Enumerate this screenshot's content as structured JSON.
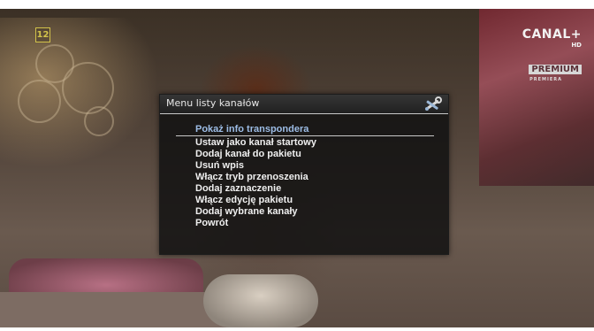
{
  "overlay": {
    "age_rating": "12",
    "channel_logo": {
      "brand": "CANAL+",
      "hd": "HD",
      "tier": "PREMIUM",
      "sub": "PREMIERA"
    }
  },
  "dialog": {
    "title": "Menu listy kanałów",
    "icon": "tools-icon",
    "selected_index": 0,
    "items": [
      "Pokaż info transpondera",
      "Ustaw jako kanał startowy",
      "Dodaj kanał do pakietu",
      "Usuń wpis",
      "Włącz tryb przenoszenia",
      "Dodaj zaznaczenie",
      "Włącz edycję pakietu",
      "Dodaj wybrane kanały",
      "Powrót"
    ]
  }
}
